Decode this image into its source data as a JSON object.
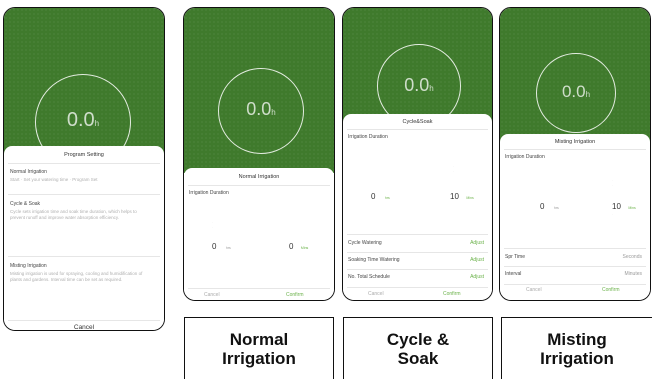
{
  "status_text": "",
  "readout_value": "0.0",
  "readout_unit": "h",
  "readout_sub": "",
  "phone1": {
    "header": "Program Setting",
    "items": [
      {
        "title": "Normal Irrigation",
        "desc": "Start · Set your watering time · Program Set"
      },
      {
        "title": "Cycle & Soak",
        "desc": "Cycle sets irrigation time and soak time duration, which helps to prevent runoff and improve water absorption efficiency."
      },
      {
        "title": "Misting Irrigation",
        "desc": "Misting irrigation is used for spraying, cooling and humidification of plants and gardens. Interval time can be set as required."
      }
    ],
    "cancel": "Cancel"
  },
  "phone2": {
    "title": "Normal Irrigation",
    "field": "Irrigation Duration",
    "hours_value": "0",
    "hours_unit": "hrs",
    "mins_value": "0",
    "mins_unit": "Mins",
    "cancel": "Cancel",
    "confirm": "Confirm"
  },
  "phone3": {
    "title": "Cycle&Soak",
    "field": "Irrigation Duration",
    "hours_value": "0",
    "hours_unit": "hrs",
    "mins_value": "10",
    "mins_unit": "Mins",
    "rows": [
      {
        "label": "Cycle Watering",
        "value": "Adjust"
      },
      {
        "label": "Soaking Time Watering",
        "value": "Adjust"
      },
      {
        "label": "No. Total Schedule",
        "value": "Adjust"
      }
    ],
    "cancel": "Cancel",
    "confirm": "Confirm"
  },
  "phone4": {
    "title": "Misting Irrigation",
    "field": "Irrigation Duration",
    "hours_value": "0",
    "hours_unit": "hrs",
    "mins_value": "10",
    "mins_unit": "Mins",
    "rows": [
      {
        "label": "Spr Time",
        "value": "Seconds"
      },
      {
        "label": "Interval",
        "value": "Minutes"
      }
    ],
    "cancel": "Cancel",
    "confirm": "Confirm"
  },
  "captions": {
    "normal_1": "Normal",
    "normal_2": "Irrigation",
    "cycle_1": "Cycle &",
    "cycle_2": "Soak",
    "misting_1": "Misting",
    "misting_2": "Irrigation"
  },
  "colors": {
    "grass": "#3f7a2c",
    "accent": "#6bb24a"
  }
}
